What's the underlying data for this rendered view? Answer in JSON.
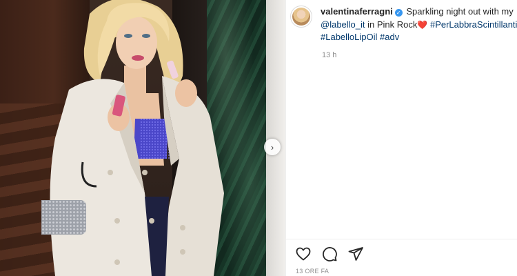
{
  "post": {
    "username": "valentinaferragni",
    "verified_icon": "verified-badge-icon",
    "caption": {
      "text_1": "Sparkling night out with my",
      "mention": "@labello_it",
      "text_2": "in Pink Rock",
      "emoji": "❤️",
      "hashtag_1": "#PerLabbraScintillanti",
      "hashtag_2_partial": "#",
      "hashtag_3": "#LabelloLipOil",
      "hashtag_4": "#adv"
    },
    "relative_time": "13 h",
    "post_age": "13 ORE FA"
  },
  "actions": {
    "icons": [
      "heart-icon",
      "comment-icon",
      "share-icon"
    ]
  },
  "carousel": {
    "next_icon": "chevron-right-icon",
    "next_glyph": "›"
  },
  "colors": {
    "link": "#00376b",
    "verified": "#3897f0",
    "secondary_text": "#8e8e8e"
  }
}
